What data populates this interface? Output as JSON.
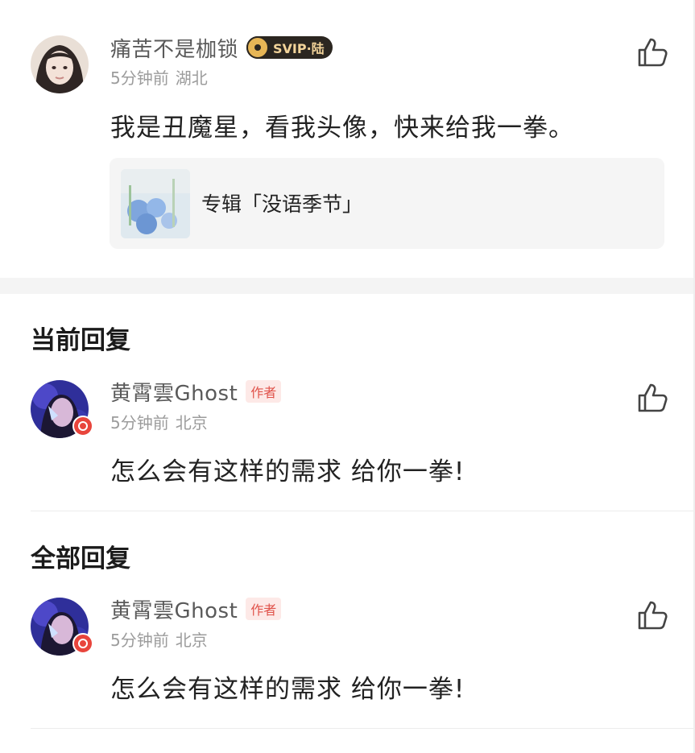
{
  "top_comment": {
    "user_name": "痛苦不是枷锁",
    "badge": "SVIP·陆",
    "time": "5分钟前",
    "location": "湖北",
    "text": "我是丑魔星，看我头像，快来给我一拳。",
    "album": {
      "label": "专辑「没语季节」",
      "cover_text": "没语季节"
    }
  },
  "current_reply": {
    "section_title": "当前回复",
    "user_name": "黄霄雲Ghost",
    "tag": "作者",
    "time": "5分钟前",
    "location": "北京",
    "text": "怎么会有这样的需求 给你一拳!"
  },
  "all_replies": {
    "section_title": "全部回复",
    "items": [
      {
        "user_name": "黄霄雲Ghost",
        "tag": "作者",
        "time": "5分钟前",
        "location": "北京",
        "text": "怎么会有这样的需求 给你一拳!"
      }
    ]
  },
  "icons": {
    "like": "thumbs-up-icon",
    "vip": "vip-disc-icon"
  },
  "colors": {
    "author_tag": "#e0524a",
    "vip_badge": "#2b2620",
    "vip_dot": "#e8453c"
  }
}
